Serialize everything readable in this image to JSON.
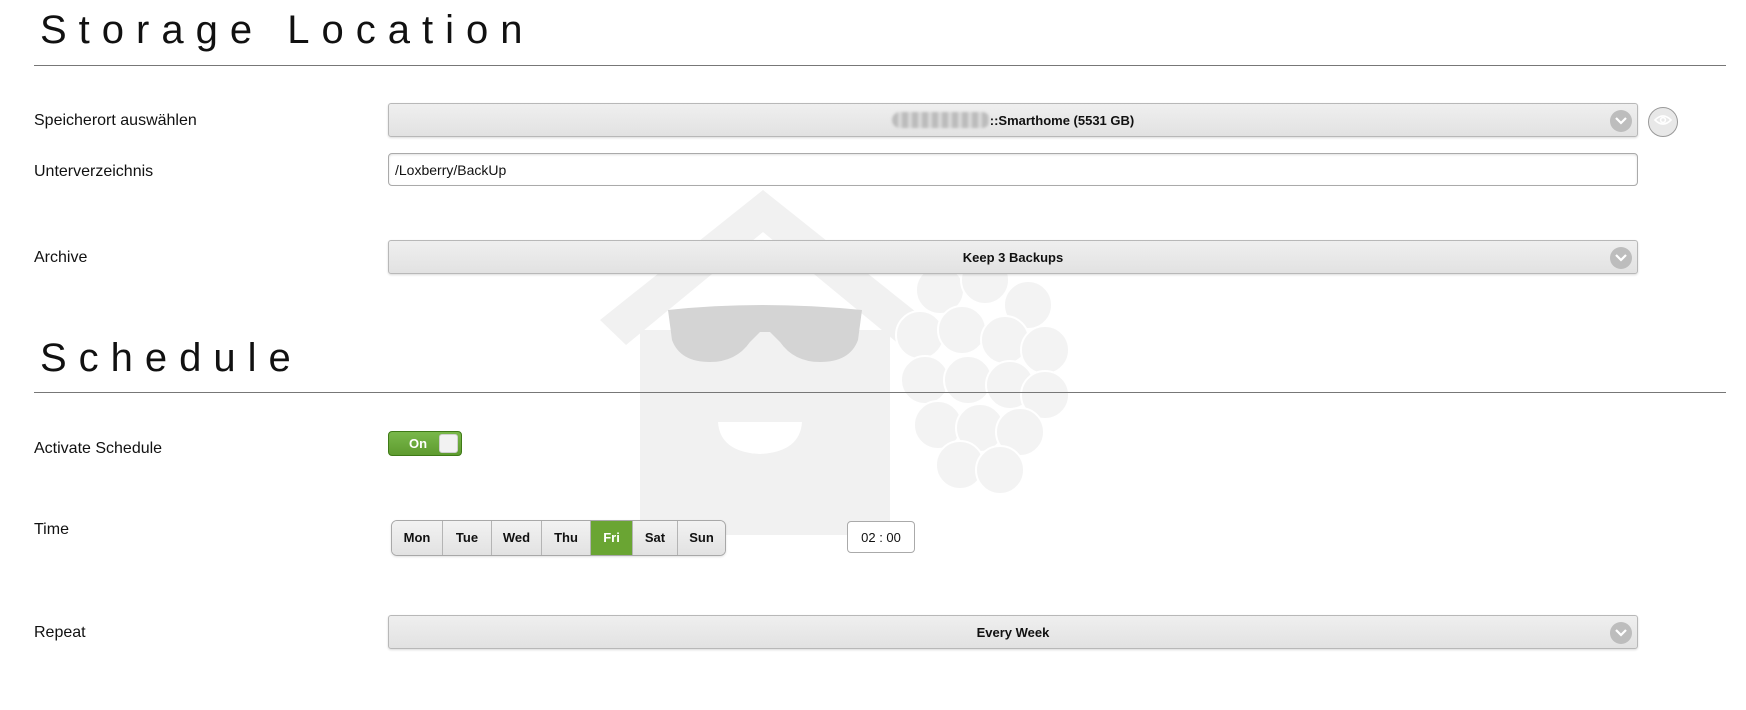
{
  "storage": {
    "title": "Storage Location",
    "location_label": "Speicherort auswählen",
    "location_value": "::Smarthome (5531 GB)",
    "subdir_label": "Unterverzeichnis",
    "subdir_value": "/Loxberry/BackUp",
    "archive_label": "Archive",
    "archive_value": "Keep 3 Backups"
  },
  "schedule": {
    "title": "Schedule",
    "activate_label": "Activate Schedule",
    "toggle_text": "On",
    "time_label": "Time",
    "days": [
      {
        "label": "Mon",
        "active": false
      },
      {
        "label": "Tue",
        "active": false
      },
      {
        "label": "Wed",
        "active": false
      },
      {
        "label": "Thu",
        "active": false
      },
      {
        "label": "Fri",
        "active": true
      },
      {
        "label": "Sat",
        "active": false
      },
      {
        "label": "Sun",
        "active": false
      }
    ],
    "time_hour": "02",
    "time_minute": "00",
    "repeat_label": "Repeat",
    "repeat_value": "Every Week"
  },
  "icons": {
    "dropdown": "chevron-down-icon",
    "browse": "eye-icon",
    "watermark": "loxberry-logo"
  },
  "colors": {
    "accent_green": "#6aa533"
  }
}
